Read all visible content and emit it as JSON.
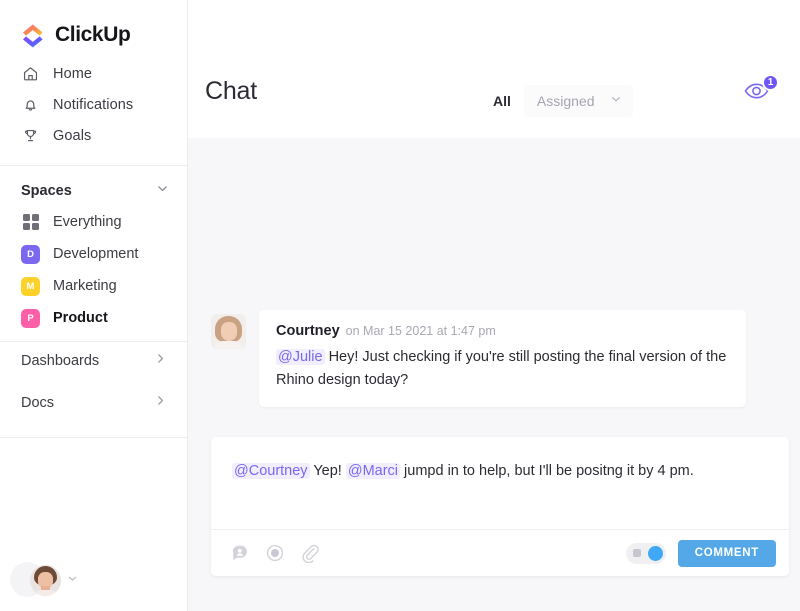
{
  "brand": {
    "name": "ClickUp",
    "logo_icon": "clickup-logo-icon",
    "accent_purple": "#7b68ee",
    "accent_blue": "#54a8e8"
  },
  "sidebar": {
    "nav": [
      {
        "label": "Home",
        "icon": "home-icon"
      },
      {
        "label": "Notifications",
        "icon": "bell-icon"
      },
      {
        "label": "Goals",
        "icon": "trophy-icon"
      }
    ],
    "spaces": {
      "title": "Spaces",
      "collapse_icon": "chevron-down-icon",
      "items": [
        {
          "label": "Everything",
          "icon": "grid-icon",
          "badge": "",
          "color": "",
          "active": false
        },
        {
          "label": "Development",
          "icon": "space-badge",
          "badge": "D",
          "color": "#7b68ee",
          "active": false
        },
        {
          "label": "Marketing",
          "icon": "space-badge",
          "badge": "M",
          "color": "#fcd12a",
          "active": false
        },
        {
          "label": "Product",
          "icon": "space-badge",
          "badge": "P",
          "color": "#fc5fa8",
          "active": true
        }
      ]
    },
    "lower": [
      {
        "label": "Dashboards",
        "icon": "chevron-right-icon"
      },
      {
        "label": "Docs",
        "icon": "chevron-right-icon"
      }
    ],
    "user": {
      "avatar_icon": "user-avatar",
      "menu_icon": "chevron-down-icon"
    }
  },
  "header": {
    "title": "Chat",
    "filter_all": "All",
    "filter_assigned": "Assigned",
    "assigned_chevron_icon": "chevron-down-icon",
    "watch_icon": "eye-watcher-icon",
    "watch_count": "1"
  },
  "messages": [
    {
      "avatar_icon": "courtney-avatar",
      "author": "Courtney",
      "timestamp": "on Mar 15 2021 at 1:47 pm",
      "mention": "@Julie",
      "text": " Hey! Just checking if you're still posting the final version of the Rhino design today?"
    }
  ],
  "composer": {
    "mention_1": "@Courtney",
    "text_1": " Yep! ",
    "mention_2": "@Marci",
    "text_2": " jumpd in to help, but I'll be positng it by 4 pm.",
    "tools": [
      {
        "icon": "mention-bubble-icon"
      },
      {
        "icon": "record-icon"
      },
      {
        "icon": "paperclip-icon"
      }
    ],
    "toggle_icon": "assign-toggle",
    "submit_label": "COMMENT"
  },
  "pointer": {
    "icon": "mouse-cursor-icon"
  }
}
